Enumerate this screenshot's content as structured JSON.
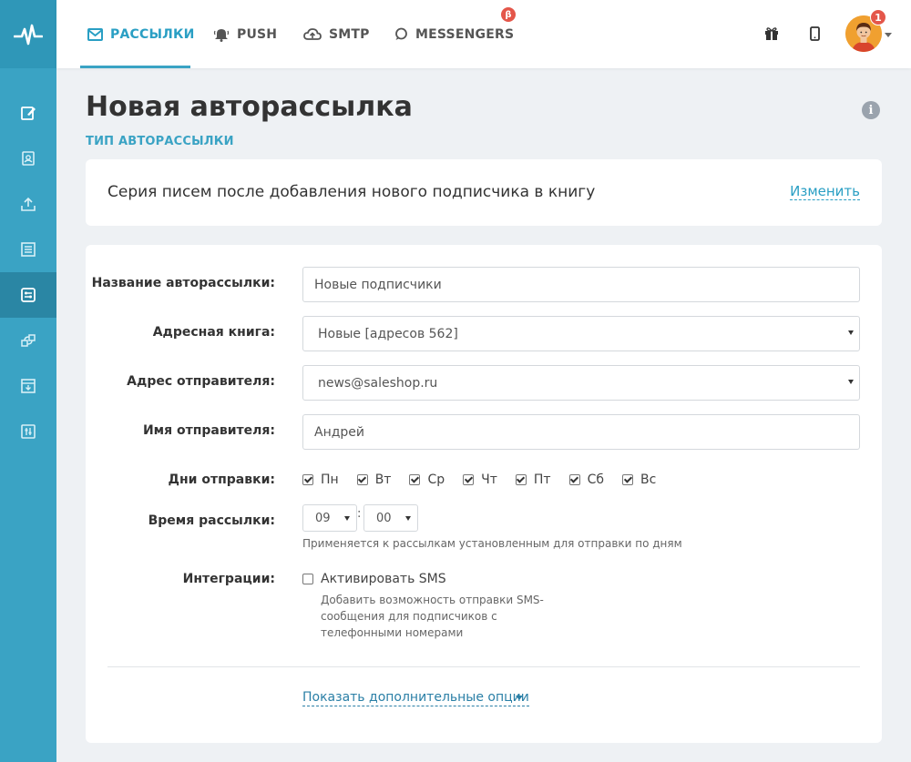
{
  "topnav": {
    "tabs": [
      {
        "label": "РАССЫЛКИ",
        "icon": "mail-icon",
        "active": true
      },
      {
        "label": "PUSH",
        "icon": "bell-icon"
      },
      {
        "label": "SMTP",
        "icon": "cloud-icon"
      },
      {
        "label": "MESSENGERS",
        "icon": "chat-icon",
        "badge": "β"
      }
    ],
    "notifications": "1"
  },
  "sidebar": {
    "items": [
      "edit-icon",
      "address-book-icon",
      "upload-icon",
      "list-icon",
      "automation-icon",
      "integration-icon",
      "archive-icon",
      "settings-icon"
    ],
    "active_index": 4
  },
  "page": {
    "title": "Новая авторассылка",
    "type_label": "ТИП АВТОРАССЫЛКИ"
  },
  "type_card": {
    "text": "Серия писем после добавления нового подписчика в книгу",
    "change": "Изменить"
  },
  "form": {
    "name_label": "Название авторассылки:",
    "name_value": "Новые подписчики",
    "book_label": "Адресная книга:",
    "book_value": "Новые [адресов 562]",
    "sender_addr_label": "Адрес отправителя:",
    "sender_addr_value": "news@saleshop.ru",
    "sender_name_label": "Имя отправителя:",
    "sender_name_value": "Андрей",
    "days_label": "Дни отправки:",
    "days": [
      "Пн",
      "Вт",
      "Ср",
      "Чт",
      "Пт",
      "Сб",
      "Вс"
    ],
    "time_label": "Время рассылки:",
    "hour": "09",
    "minute": "00",
    "time_hint": "Применяется к рассылкам установленным для отправки по дням",
    "integrations_label": "Интеграции:",
    "sms_label": "Активировать SMS",
    "sms_desc": "Добавить возможность отправки SMS-сообщения для подписчиков с телефонными номерами",
    "more_options": "Показать дополнительные опции"
  },
  "colors": {
    "accent": "#3aa3c4",
    "sidebar": "#3aa3c4",
    "badge": "#e4564a"
  }
}
